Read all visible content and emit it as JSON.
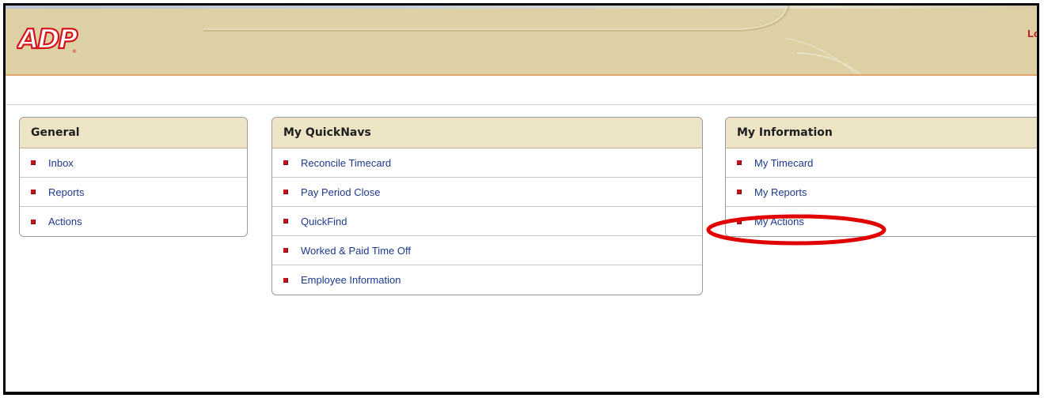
{
  "header": {
    "logo_text": "ADP",
    "right_text": "Lo",
    "colors": {
      "background": "#ddd0a4",
      "accent_line": "#e0a368",
      "logo_red": "#d4131a"
    }
  },
  "panels": [
    {
      "title": "General",
      "items": [
        {
          "label": "Inbox"
        },
        {
          "label": "Reports"
        },
        {
          "label": "Actions"
        }
      ]
    },
    {
      "title": "My QuickNavs",
      "items": [
        {
          "label": "Reconcile Timecard"
        },
        {
          "label": "Pay Period Close"
        },
        {
          "label": "QuickFind"
        },
        {
          "label": "Worked & Paid Time Off"
        },
        {
          "label": "Employee Information"
        }
      ]
    },
    {
      "title": "My Information",
      "items": [
        {
          "label": "My Timecard"
        },
        {
          "label": "My Reports"
        },
        {
          "label": "My Actions"
        }
      ]
    }
  ],
  "annotation": {
    "type": "ellipse-highlight",
    "target": "My Actions",
    "color": "#e00000"
  },
  "colors": {
    "link": "#1c3a8c",
    "bullet": "#c4141b",
    "panel_header": "#ece4c4"
  }
}
